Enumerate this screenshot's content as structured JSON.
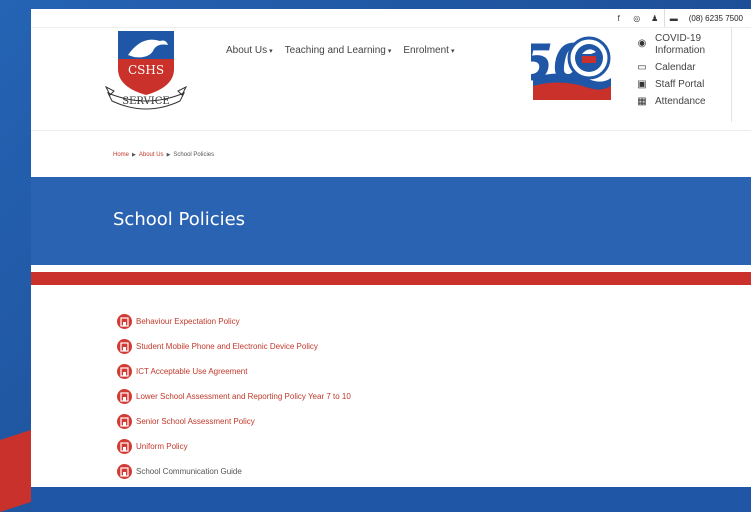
{
  "topbar": {
    "icons": [
      "facebook-icon",
      "instagram-icon",
      "user-icon",
      "phone-icon"
    ],
    "phone": "(08) 6235 7500"
  },
  "logo": {
    "text": "CSHS",
    "banner": "SERVICE"
  },
  "badge": {
    "number": "50"
  },
  "nav": {
    "items": [
      {
        "label": "About Us"
      },
      {
        "label": "Teaching and Learning"
      },
      {
        "label": "Enrolment"
      }
    ]
  },
  "quick_links": [
    {
      "icon": "globe-icon",
      "label_line1": "COVID-19",
      "label_line2": "Information"
    },
    {
      "icon": "calendar-icon",
      "label_line1": "Calendar",
      "label_line2": ""
    },
    {
      "icon": "staff-icon",
      "label_line1": "Staff Portal",
      "label_line2": ""
    },
    {
      "icon": "attendance-icon",
      "label_line1": "Attendance",
      "label_line2": ""
    }
  ],
  "breadcrumb": {
    "home": "Home",
    "about": "About Us",
    "current": "School Policies"
  },
  "banner": {
    "title": "School Policies"
  },
  "policies": [
    {
      "label": "Behaviour Expectation Policy"
    },
    {
      "label": "Student Mobile Phone and Electronic Device Policy"
    },
    {
      "label": "ICT Acceptable Use Agreement"
    },
    {
      "label": "Lower School Assessment and Reporting Policy Year 7 to 10"
    },
    {
      "label": "Senior School Assessment Policy"
    },
    {
      "label": "Uniform Policy"
    },
    {
      "label": "School Communication Guide"
    }
  ],
  "colors": {
    "brand_blue": "#2b63b3",
    "brand_red": "#c9312a",
    "link_red": "#c0392b"
  }
}
